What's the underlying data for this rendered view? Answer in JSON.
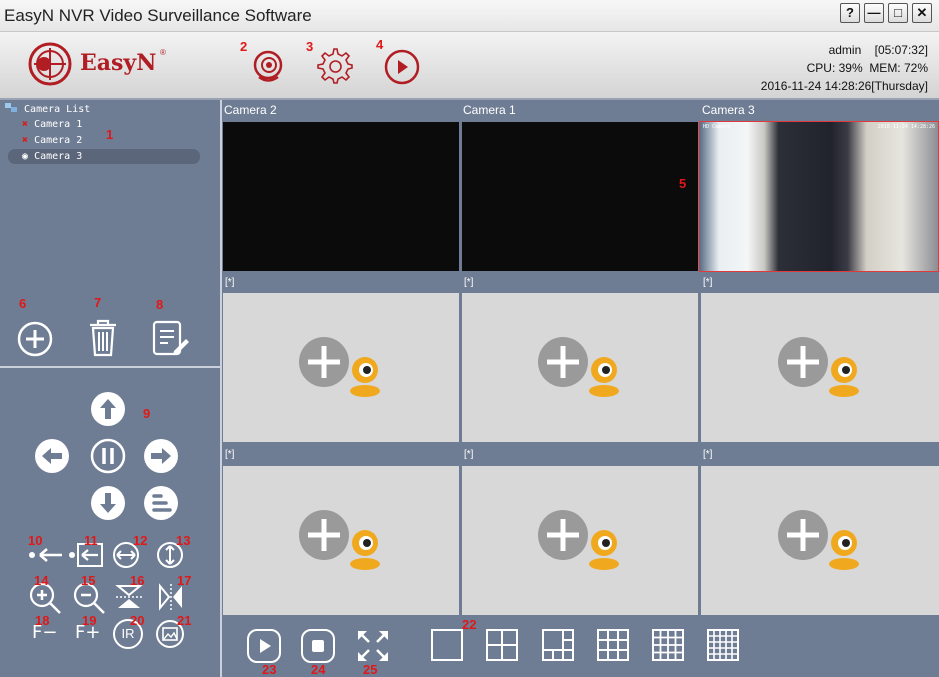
{
  "window": {
    "title": "EasyN NVR Video Surveillance Software",
    "help_label": "?",
    "min_label": "—",
    "max_label": "□",
    "close_label": "✕"
  },
  "brand": {
    "name": "EasyN",
    "reg": "®"
  },
  "toolbar": {
    "camera_icon": "webcam-icon",
    "settings_icon": "gear-icon",
    "playback_icon": "play-circle-icon"
  },
  "system": {
    "user": "admin",
    "uptime": "[05:07:32]",
    "cpu": "CPU: 39%",
    "mem": "MEM: 72%",
    "datetime": "2016-11-24 14:28:26[Thursday]"
  },
  "camera_tree": {
    "root": "Camera List",
    "items": [
      "Camera 1",
      "Camera 2",
      "Camera 3"
    ],
    "selected": "Camera 3"
  },
  "grid": {
    "cells": [
      "Camera 2",
      "Camera 1",
      "Camera 3",
      "[*]",
      "[*]",
      "[*]",
      "[*]",
      "[*]",
      "[*]"
    ],
    "live_caption_left": "HD Camera",
    "live_caption_right": "2016-11-24 14:28:26"
  },
  "ptz": {
    "focus_minus": "F−",
    "focus_plus": "F+",
    "ir": "IR"
  },
  "annotations": [
    "1",
    "2",
    "3",
    "4",
    "5",
    "6",
    "7",
    "8",
    "9",
    "10",
    "11",
    "12",
    "13",
    "14",
    "15",
    "16",
    "17",
    "18",
    "19",
    "20",
    "21",
    "22",
    "23",
    "24",
    "25"
  ],
  "colors": {
    "accent_red": "#b01e24",
    "annotation": "#e01818",
    "panel": "#6f7d94"
  }
}
